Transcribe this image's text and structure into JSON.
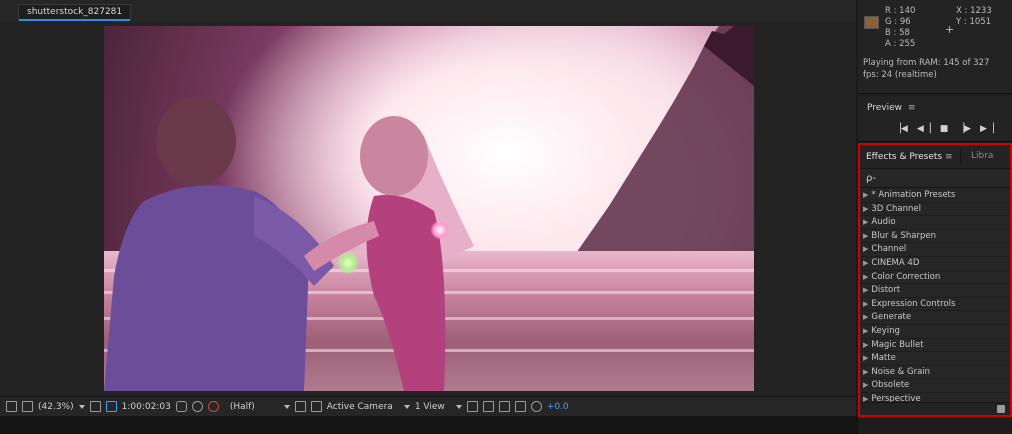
{
  "composition_tab": {
    "label": "shutterstock_827281"
  },
  "viewer_toolbar": {
    "zoom": "(42.3%)",
    "timecode": "1:00:02:03",
    "resolution": "(Half)",
    "camera": "Active Camera",
    "views": "1 View",
    "exposure": "+0.0"
  },
  "info": {
    "r": "R : 140",
    "g": "G : 96",
    "b": "B : 58",
    "a": "A : 255",
    "x": "X : 1233",
    "y": "Y : 1051",
    "swatch_color": "#8c603a",
    "playing": "Playing from RAM: 145 of 327",
    "fps": "fps: 24 (realtime)"
  },
  "preview": {
    "title": "Preview",
    "menu": "≡",
    "controls": [
      "▕◀",
      "◀▕",
      "■",
      "▕▶",
      "▶▕"
    ]
  },
  "effects_presets": {
    "tab_label": "Effects & Presets",
    "menu": "≡",
    "library_tab": "Libra",
    "search_icon": "ρ-",
    "items": [
      "* Animation Presets",
      "3D Channel",
      "Audio",
      "Blur & Sharpen",
      "Channel",
      "CINEMA 4D",
      "Color Correction",
      "Distort",
      "Expression Controls",
      "Generate",
      "Keying",
      "Magic Bullet",
      "Matte",
      "Noise & Grain",
      "Obsolete",
      "Perspective"
    ]
  },
  "colors": {
    "highlight_border": "#d40000",
    "active_tab_underline": "#2d8ceb",
    "exposure_text": "#4a9ee8"
  }
}
